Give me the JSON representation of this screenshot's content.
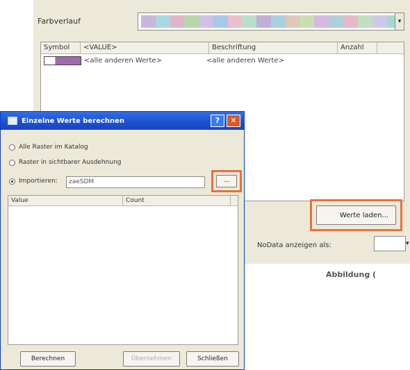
{
  "background_dialog": {
    "color_ramp_label": "Farbverlauf",
    "color_ramp_colors": [
      "#c8b6e0",
      "#a8d8e0",
      "#e0b6c8",
      "#b6d8a8",
      "#d0c0e8",
      "#a8c8e8",
      "#e8c0d0",
      "#b8e0c8",
      "#c0b0d8",
      "#a8d0e0",
      "#e0c8b8",
      "#c8e0b0",
      "#d8b8e0",
      "#b0d0d8",
      "#e8b8c8",
      "#c0e0c0",
      "#d0c8e8",
      "#a8d8d0"
    ],
    "dropdown_arrow": "▾",
    "columns": [
      "Symbol",
      "<VALUE>",
      "Beschriftung",
      "Anzahl"
    ],
    "rows": [
      {
        "value": "<alle anderen Werte>",
        "label": "<alle anderen Werte>"
      }
    ],
    "werte_button": "Werte laden...",
    "nodata_label": "NoData anzeigen als:",
    "nodata_arrow": "▾"
  },
  "caption": "Abbildung (",
  "dialog": {
    "title": "Einzelne Werte berechnen",
    "help_label": "?",
    "close_label": "✕",
    "options": [
      {
        "label": "Alle Raster im Katalog",
        "selected": false
      },
      {
        "label": "Raster in sichtbarer Ausdehnung",
        "selected": false
      },
      {
        "label": "Importieren:",
        "selected": true
      }
    ],
    "import_value": "zaeSDM",
    "browse_label": "...",
    "columns": [
      "Value",
      "Count"
    ],
    "buttons": {
      "compute": "Berechnen",
      "apply": "Übernehmen",
      "close": "Schließen"
    }
  },
  "colors": {
    "highlight": "#e8713a",
    "titlebar": "#1c4fd0",
    "close": "#d9582b"
  }
}
